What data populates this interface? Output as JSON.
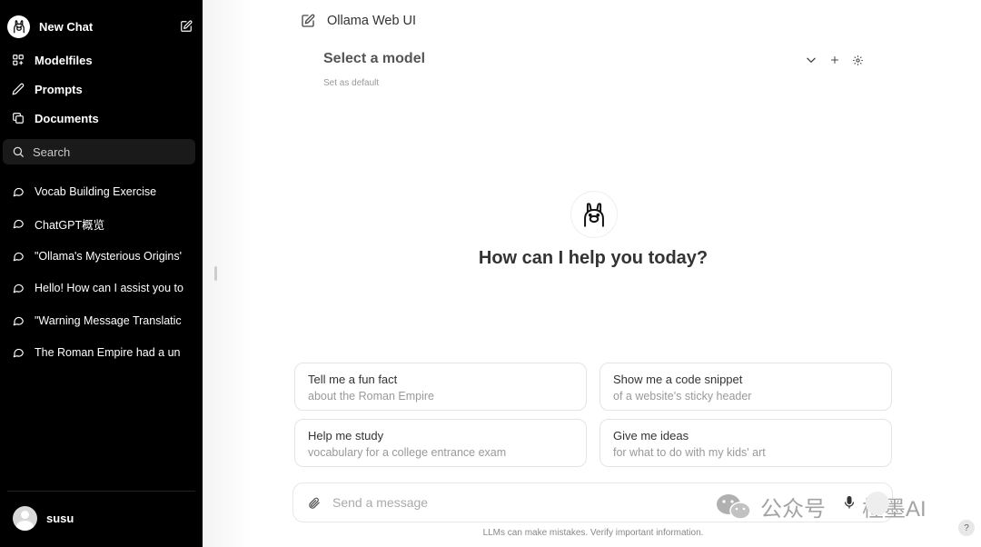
{
  "sidebar": {
    "new_chat": "New Chat",
    "nav": [
      {
        "label": "Modelfiles",
        "icon": "grid-icon"
      },
      {
        "label": "Prompts",
        "icon": "pencil-icon"
      },
      {
        "label": "Documents",
        "icon": "documents-icon"
      }
    ],
    "search_placeholder": "Search",
    "chats": [
      "Vocab Building Exercise",
      "ChatGPT概览",
      "\"Ollama's Mysterious Origins'",
      "Hello! How can I assist you to",
      "\"Warning Message Translatic",
      "The Roman Empire had a un"
    ],
    "user": "susu"
  },
  "header": {
    "app_title": "Ollama Web UI"
  },
  "model": {
    "select_label": "Select a model",
    "set_default": "Set as default"
  },
  "hero": {
    "greeting": "How can I help you today?"
  },
  "suggestions": [
    {
      "title": "Tell me a fun fact",
      "subtitle": "about the Roman Empire"
    },
    {
      "title": "Show me a code snippet",
      "subtitle": "of a website's sticky header"
    },
    {
      "title": "Help me study",
      "subtitle": "vocabulary for a college entrance exam"
    },
    {
      "title": "Give me ideas",
      "subtitle": "for what to do with my kids' art"
    }
  ],
  "composer": {
    "placeholder": "Send a message"
  },
  "footer": {
    "disclaimer": "LLMs can make mistakes. Verify important information.",
    "help": "?"
  },
  "watermark": {
    "left": "公众号",
    "right": "槿墨AI"
  }
}
